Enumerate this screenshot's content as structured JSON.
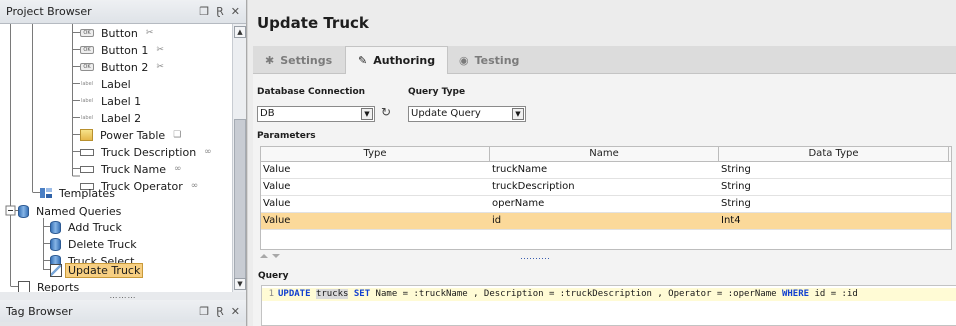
{
  "project_browser": {
    "title": "Project Browser",
    "controls": [
      "restore-icon",
      "pin-icon",
      "close-icon"
    ],
    "items": [
      {
        "label": "Button",
        "icon": "button-component-icon",
        "suffix": "script-icon"
      },
      {
        "label": "Button 1",
        "icon": "button-component-icon",
        "suffix": "script-icon"
      },
      {
        "label": "Button 2",
        "icon": "button-component-icon",
        "suffix": "script-icon"
      },
      {
        "label": "Label",
        "icon": "label-component-icon"
      },
      {
        "label": "Label 1",
        "icon": "label-component-icon"
      },
      {
        "label": "Label 2",
        "icon": "label-component-icon"
      },
      {
        "label": "Power Table",
        "icon": "power-table-icon",
        "suffix": "script-icon"
      },
      {
        "label": "Truck Description",
        "icon": "text-field-icon",
        "suffix": "binding-icon"
      },
      {
        "label": "Truck Name",
        "icon": "text-field-icon",
        "suffix": "binding-icon"
      },
      {
        "label": "Truck Operator",
        "icon": "text-field-icon",
        "suffix": "binding-icon"
      },
      {
        "label": "Templates",
        "icon": "templates-icon"
      },
      {
        "label": "Named Queries",
        "icon": "database-icon"
      },
      {
        "label": "Add Truck",
        "icon": "named-query-icon"
      },
      {
        "label": "Delete Truck",
        "icon": "named-query-icon"
      },
      {
        "label": "Truck Select",
        "icon": "named-query-icon"
      },
      {
        "label": "Update Truck",
        "icon": "named-query-edit-icon",
        "selected": true
      },
      {
        "label": "Reports",
        "icon": "reports-icon"
      }
    ]
  },
  "tag_browser": {
    "title": "Tag Browser",
    "controls": [
      "restore-icon",
      "pin-icon",
      "close-icon"
    ]
  },
  "editor": {
    "title": "Update Truck",
    "tabs": [
      {
        "label": "Settings",
        "icon": "gear-icon",
        "active": false
      },
      {
        "label": "Authoring",
        "icon": "pencil-icon",
        "active": true
      },
      {
        "label": "Testing",
        "icon": "eye-icon",
        "active": false
      }
    ],
    "database_connection_label": "Database Connection",
    "database_connection_value": "DB",
    "query_type_label": "Query Type",
    "query_type_value": "Update Query",
    "parameters_label": "Parameters",
    "parameters_columns": [
      "Type",
      "Name",
      "Data Type"
    ],
    "parameters_rows": [
      {
        "type": "Value",
        "name": "truckName",
        "data_type": "String"
      },
      {
        "type": "Value",
        "name": "truckDescription",
        "data_type": "String"
      },
      {
        "type": "Value",
        "name": "operName",
        "data_type": "String"
      },
      {
        "type": "Value",
        "name": "id",
        "data_type": "Int4",
        "selected": true
      }
    ],
    "query_label": "Query",
    "query_line_number": "1",
    "query_tokens": [
      {
        "t": "UPDATE",
        "k": "kw"
      },
      {
        "t": " ",
        "k": "id"
      },
      {
        "t": "trucks",
        "k": "tbl"
      },
      {
        "t": " ",
        "k": "id"
      },
      {
        "t": "SET",
        "k": "kw"
      },
      {
        "t": " Name = :truckName , Description = :truckDescription , Operator = :operName ",
        "k": "id"
      },
      {
        "t": "WHERE",
        "k": "kw"
      },
      {
        "t": " id = :id",
        "k": "id"
      }
    ]
  }
}
